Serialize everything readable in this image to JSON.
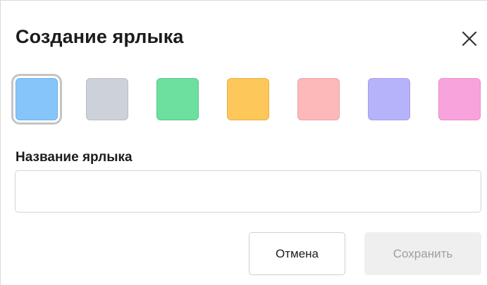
{
  "dialog": {
    "title": "Создание ярлыка",
    "close_icon": "close-icon",
    "colors": [
      {
        "name": "blue",
        "fill": "#86c5fa",
        "border": "#6bb0ea",
        "selected": true
      },
      {
        "name": "gray",
        "fill": "#cdd2da",
        "border": "#b7bcc4",
        "selected": false
      },
      {
        "name": "green",
        "fill": "#6ddf9f",
        "border": "#55c888",
        "selected": false
      },
      {
        "name": "yellow",
        "fill": "#fdc75a",
        "border": "#e8b043",
        "selected": false
      },
      {
        "name": "pink",
        "fill": "#fdb8b9",
        "border": "#eaa3a4",
        "selected": false
      },
      {
        "name": "violet",
        "fill": "#b7b3fb",
        "border": "#a29ee8",
        "selected": false
      },
      {
        "name": "magenta",
        "fill": "#f8a3db",
        "border": "#e58ec7",
        "selected": false
      }
    ],
    "name_label": "Название ярлыка",
    "name_value": "",
    "cancel_label": "Отмена",
    "save_label": "Сохранить"
  }
}
